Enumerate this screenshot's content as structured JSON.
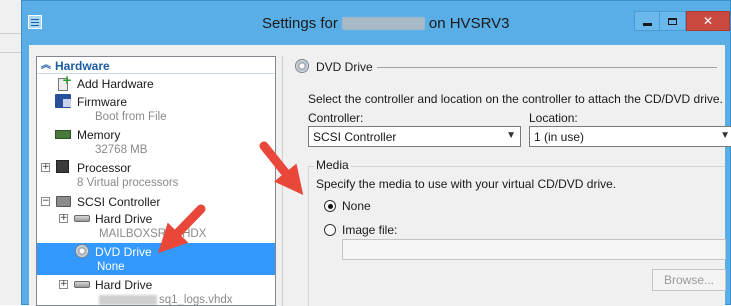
{
  "window": {
    "title_prefix": "Settings for",
    "title_suffix": "on HVSRV3",
    "controls": {
      "minimize": "minimize",
      "maximize": "maximize",
      "close": "✕"
    }
  },
  "tree": {
    "section": "Hardware",
    "items": [
      {
        "label": "Add Hardware",
        "sub": ""
      },
      {
        "label": "Firmware",
        "sub": "Boot from File"
      },
      {
        "label": "Memory",
        "sub": "32768 MB"
      },
      {
        "label": "Processor",
        "sub": "8 Virtual processors"
      },
      {
        "label": "SCSI Controller",
        "sub": ""
      },
      {
        "label": "Hard Drive",
        "sub": "MAILBOXSRV...HDX"
      },
      {
        "label": "DVD Drive",
        "sub": "None"
      },
      {
        "label": "Hard Drive",
        "sub": "sq1_logs.vhdx"
      }
    ],
    "expanders": {
      "processor": "+",
      "scsi": "−",
      "hard_drive_1": "+",
      "hard_drive_2": "+"
    }
  },
  "details": {
    "header": "DVD Drive",
    "description": "Select the controller and location on the controller to attach the CD/DVD drive.",
    "controller": {
      "label": "Controller:",
      "value": "SCSI Controller"
    },
    "location": {
      "label": "Location:",
      "value": "1 (in use)"
    },
    "media": {
      "legend": "Media",
      "description": "Specify the media to use with your virtual CD/DVD drive.",
      "option_none": "None",
      "option_image": "Image file:",
      "selected": "None",
      "image_path": "",
      "browse_label": "Browse..."
    }
  },
  "colors": {
    "titlebar": "#5aaee6",
    "selection": "#3399ff",
    "accent_text": "#1c5da3",
    "annotation_arrow": "#e8473a",
    "close_button": "#c94a3f"
  }
}
